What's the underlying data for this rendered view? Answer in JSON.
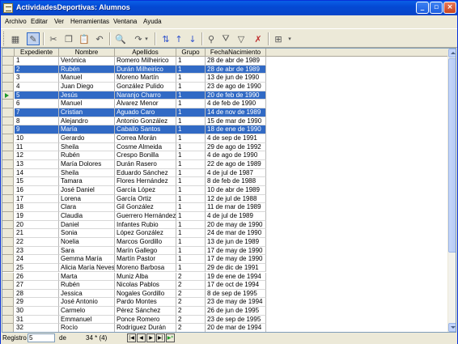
{
  "window": {
    "title": "ActividadesDeportivas: Alumnos"
  },
  "menu": [
    "Archivo",
    "Editar",
    "Ver",
    "Herramientas",
    "Ventana",
    "Ayuda"
  ],
  "toolbar_icons": [
    "grid-view-icon",
    "edit-mode-icon",
    "cut-icon",
    "copy-icon",
    "paste-icon",
    "undo-icon",
    "find-icon",
    "redo-icon",
    "sort-icon",
    "sort-ascending-icon",
    "sort-descending-icon",
    "autofilter-icon",
    "filter-icon",
    "standard-filter-icon",
    "remove-filter-icon",
    "data-source-icon"
  ],
  "columns": [
    "Expediente",
    "Nombre",
    "Apellidos",
    "Grupo",
    "FechaNacimiento"
  ],
  "rows": [
    [
      "1",
      "Verónica",
      "Romero Milheirico",
      "1",
      "28 de abr de 1989"
    ],
    [
      "2",
      "Rubén",
      "Durán Milheirico",
      "1",
      "28 de abr de 1989"
    ],
    [
      "3",
      "Manuel",
      "Moreno Martín",
      "1",
      "13 de jun de 1990"
    ],
    [
      "4",
      "Juan Diego",
      "González Pulido",
      "1",
      "23 de ago de 1990"
    ],
    [
      "5",
      "Jesús",
      "Naranjo Charro",
      "1",
      "20 de feb de 1990"
    ],
    [
      "6",
      "Manuel",
      "Álvarez Menor",
      "1",
      "4 de feb de 1990"
    ],
    [
      "7",
      "Cristian",
      "Aguado Caro",
      "1",
      "14 de nov de 1989"
    ],
    [
      "8",
      "Alejandro",
      "Antonio González",
      "1",
      "15 de mar de 1990"
    ],
    [
      "9",
      "María",
      "Caballo Santos",
      "1",
      "18 de ene de 1990"
    ],
    [
      "10",
      "Gerardo",
      "Correa Morán",
      "1",
      "4 de sep de 1991"
    ],
    [
      "11",
      "Sheila",
      "Cosme Almeida",
      "1",
      "29 de ago de 1992"
    ],
    [
      "12",
      "Rubén",
      "Crespo Bonilla",
      "1",
      "4 de ago de 1990"
    ],
    [
      "13",
      "María Dolores",
      "Durán Rasero",
      "1",
      "22 de ago de 1989"
    ],
    [
      "14",
      "Sheila",
      "Eduardo Sánchez",
      "1",
      "4 de jul de 1987"
    ],
    [
      "15",
      "Tamara",
      "Flores Hernández",
      "1",
      "8 de feb de 1988"
    ],
    [
      "16",
      "José Daniel",
      "García López",
      "1",
      "10 de abr de 1989"
    ],
    [
      "17",
      "Lorena",
      "García Ortiz",
      "1",
      "12 de jul de 1988"
    ],
    [
      "18",
      "Clara",
      "Gil González",
      "1",
      "11 de mar de 1989"
    ],
    [
      "19",
      "Claudia",
      "Guerrero Hernández",
      "1",
      "4 de jul de 1989"
    ],
    [
      "20",
      "Daniel",
      "Infantes Rubio",
      "1",
      "20 de may de 1990"
    ],
    [
      "21",
      "Sonia",
      "López González",
      "1",
      "24 de mar de 1990"
    ],
    [
      "22",
      "Noelia",
      "Marcos Gordillo",
      "1",
      "13 de jun de 1989"
    ],
    [
      "23",
      "Sara",
      "Marín Gallego",
      "1",
      "17 de may de 1990"
    ],
    [
      "24",
      "Gemma María",
      "Martín Pastor",
      "1",
      "17 de may de 1990"
    ],
    [
      "25",
      "Alicia María Neves",
      "Moreno Barbosa",
      "1",
      "29 de dic de 1991"
    ],
    [
      "26",
      "Marta",
      "Muniz Alba",
      "2",
      "19 de ene de 1994"
    ],
    [
      "27",
      "Rubén",
      "Nicolas Pablos",
      "2",
      "17 de oct de 1994"
    ],
    [
      "28",
      "Jessica",
      "Nogales Gordillo",
      "2",
      "8 de sep de 1995"
    ],
    [
      "29",
      "José Antonio",
      "Pardo Montes",
      "2",
      "23 de may de 1994"
    ],
    [
      "30",
      "Carmelo",
      "Pérez Sánchez",
      "2",
      "26 de jun de 1995"
    ],
    [
      "31",
      "Emmanuel",
      "Ponce Romero",
      "2",
      "23 de sep de 1995"
    ],
    [
      "32",
      "Rocío",
      "Rodríguez Durán",
      "2",
      "20 de mar de 1994"
    ]
  ],
  "selected_rows": [
    2,
    5,
    7,
    9
  ],
  "current_row": 5,
  "status": {
    "label": "Registro",
    "record": "5",
    "of_label": "de",
    "count": "34 * (4)"
  },
  "colors": {
    "selection": "#316AC5",
    "title_bar": "#0449D4",
    "current_marker": "#1F9A2A"
  }
}
